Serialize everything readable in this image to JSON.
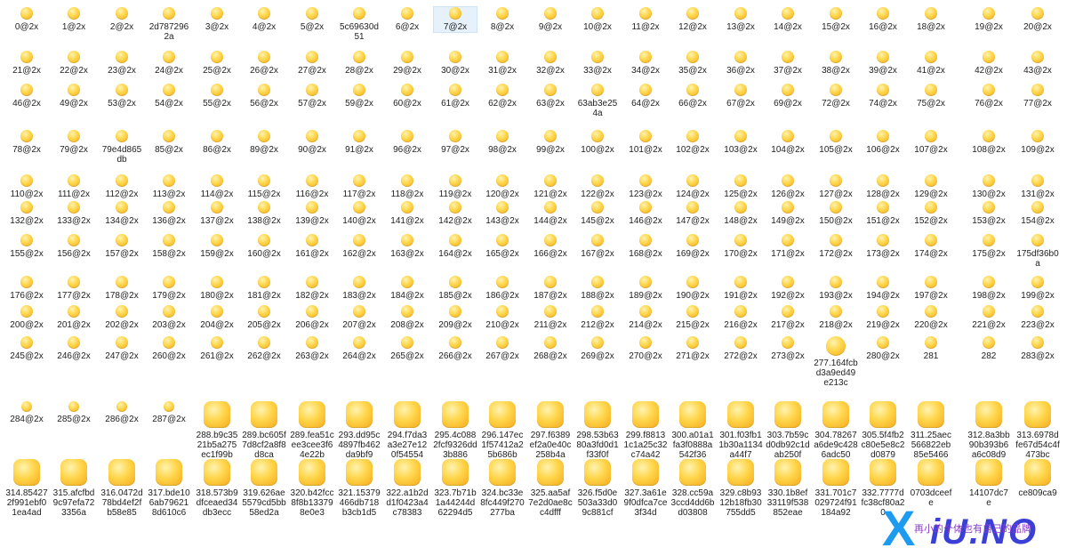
{
  "files": [
    [
      "0@2x",
      "1@2x",
      "2@2x",
      "2d7872962a",
      "3@2x",
      "4@2x",
      "5@2x",
      "5c69630d51",
      "6@2x",
      "7@2x",
      "8@2x",
      "9@2x",
      "10@2x",
      "11@2x",
      "12@2x",
      "13@2x",
      "14@2x",
      "15@2x",
      "16@2x",
      "18@2x",
      "19@2x",
      "20@2x"
    ],
    [
      "21@2x",
      "22@2x",
      "23@2x",
      "24@2x",
      "25@2x",
      "26@2x",
      "27@2x",
      "28@2x",
      "29@2x",
      "30@2x",
      "31@2x",
      "32@2x",
      "33@2x",
      "34@2x",
      "35@2x",
      "36@2x",
      "37@2x",
      "38@2x",
      "39@2x",
      "41@2x",
      "42@2x",
      "43@2x"
    ],
    [
      "46@2x",
      "49@2x",
      "53@2x",
      "54@2x",
      "55@2x",
      "56@2x",
      "57@2x",
      "59@2x",
      "60@2x",
      "61@2x",
      "62@2x",
      "63@2x",
      "63ab3e254a",
      "64@2x",
      "66@2x",
      "67@2x",
      "69@2x",
      "72@2x",
      "74@2x",
      "75@2x",
      "76@2x",
      "77@2x"
    ],
    [
      "78@2x",
      "79@2x",
      "79e4d865db",
      "85@2x",
      "86@2x",
      "89@2x",
      "90@2x",
      "91@2x",
      "96@2x",
      "97@2x",
      "98@2x",
      "99@2x",
      "100@2x",
      "101@2x",
      "102@2x",
      "103@2x",
      "104@2x",
      "105@2x",
      "106@2x",
      "107@2x",
      "108@2x",
      "109@2x"
    ],
    [
      "110@2x",
      "111@2x",
      "112@2x",
      "113@2x",
      "114@2x",
      "115@2x",
      "116@2x",
      "117@2x",
      "118@2x",
      "119@2x",
      "120@2x",
      "121@2x",
      "122@2x",
      "123@2x",
      "124@2x",
      "125@2x",
      "126@2x",
      "127@2x",
      "128@2x",
      "129@2x",
      "130@2x",
      "131@2x"
    ],
    [
      "132@2x",
      "133@2x",
      "134@2x",
      "136@2x",
      "137@2x",
      "138@2x",
      "139@2x",
      "140@2x",
      "141@2x",
      "142@2x",
      "143@2x",
      "144@2x",
      "145@2x",
      "146@2x",
      "147@2x",
      "148@2x",
      "149@2x",
      "150@2x",
      "151@2x",
      "152@2x",
      "153@2x",
      "154@2x"
    ],
    [
      "155@2x",
      "156@2x",
      "157@2x",
      "158@2x",
      "159@2x",
      "160@2x",
      "161@2x",
      "162@2x",
      "163@2x",
      "164@2x",
      "165@2x",
      "166@2x",
      "167@2x",
      "168@2x",
      "169@2x",
      "170@2x",
      "171@2x",
      "172@2x",
      "173@2x",
      "174@2x",
      "175@2x",
      "175df36b0a"
    ],
    [
      "176@2x",
      "177@2x",
      "178@2x",
      "179@2x",
      "180@2x",
      "181@2x",
      "182@2x",
      "183@2x",
      "184@2x",
      "185@2x",
      "186@2x",
      "187@2x",
      "188@2x",
      "189@2x",
      "190@2x",
      "191@2x",
      "192@2x",
      "193@2x",
      "194@2x",
      "197@2x",
      "198@2x",
      "199@2x"
    ],
    [
      "200@2x",
      "201@2x",
      "202@2x",
      "203@2x",
      "204@2x",
      "205@2x",
      "206@2x",
      "207@2x",
      "208@2x",
      "209@2x",
      "210@2x",
      "211@2x",
      "212@2x",
      "214@2x",
      "215@2x",
      "216@2x",
      "217@2x",
      "218@2x",
      "219@2x",
      "220@2x",
      "221@2x",
      "223@2x"
    ],
    [
      "245@2x",
      "246@2x",
      "247@2x",
      "260@2x",
      "261@2x",
      "262@2x",
      "263@2x",
      "264@2x",
      "265@2x",
      "266@2x",
      "267@2x",
      "268@2x",
      "269@2x",
      "270@2x",
      "271@2x",
      "272@2x",
      "273@2x",
      "277.164fcbd3a9ed49e213c",
      "280@2x",
      "281",
      "282",
      "283@2x"
    ],
    [
      "284@2x",
      "285@2x",
      "286@2x",
      "287@2x",
      "288.b9c3521b5a275ec1f99b",
      "289.bc605f7d8cf2a8f8d8ca",
      "289.fea51cee3cee3f64e22b",
      "293.dd95c4897fb462da9bf9",
      "294.f7da3a3e27e120f54554",
      "295.4c0882fcf9326dd3b886",
      "296.147ec1f57412a25b686b",
      "297.f6389ef2a0e40c258b4a",
      "298.53b6380a3fd0d1f33f0f",
      "299.f88131c1a25c32c74a42",
      "300.a01a1fa3f0888a542f36",
      "301.f03fb11b30a1134a44f7",
      "303.7b59cd0db92c1dab250f",
      "304.78267a6de9c4286adc50",
      "305.5f4fb2c80e5e8c2d0879",
      "311.25aec566822eb85e5466",
      "312.8a3bb90b393b6a6c08d9",
      "313.6978dfe67d54c4f473bc"
    ],
    [
      "314.854272f991ebf01ea4ad",
      "315.afcfbd9c97efa723356a",
      "316.0472d78bd4ef2fb58e85",
      "317.bde106ab796218d610c6",
      "318.573b9dfceaed34db3ecc",
      "319.626ae5579cd5bb58ed2a",
      "320.b42fcc8f8b133798e0e3",
      "321.15379466db718b3cb1d5",
      "322.a1b2dd1f0423a4c78383",
      "323.7b71b1a44244d62294d5",
      "324.bc33e8fc449f270277ba",
      "325.aa5af7e2d0ae8cc4dfff",
      "326.f5d0e503a33d09c881cf",
      "327.3a61e9f0dfca7ce3f34d",
      "328.cc59a3ccd4dd6bd03808",
      "329.c8b9312b18fb30755dd5",
      "330.1b8ef33119f538852eae",
      "331.701c7029724f91184a92",
      "332.7777dfc38cf80a20",
      "0703dceefe",
      "14107dc7e",
      "ce809ca9"
    ]
  ],
  "selected_file": "7@2x",
  "accent_color": "#ffd54a",
  "selection_color": "#e6f1fb",
  "watermark": {
    "logo_x": "X",
    "logo_rest": "iU.NO",
    "tagline": "再小的个体也有自己的品牌"
  }
}
